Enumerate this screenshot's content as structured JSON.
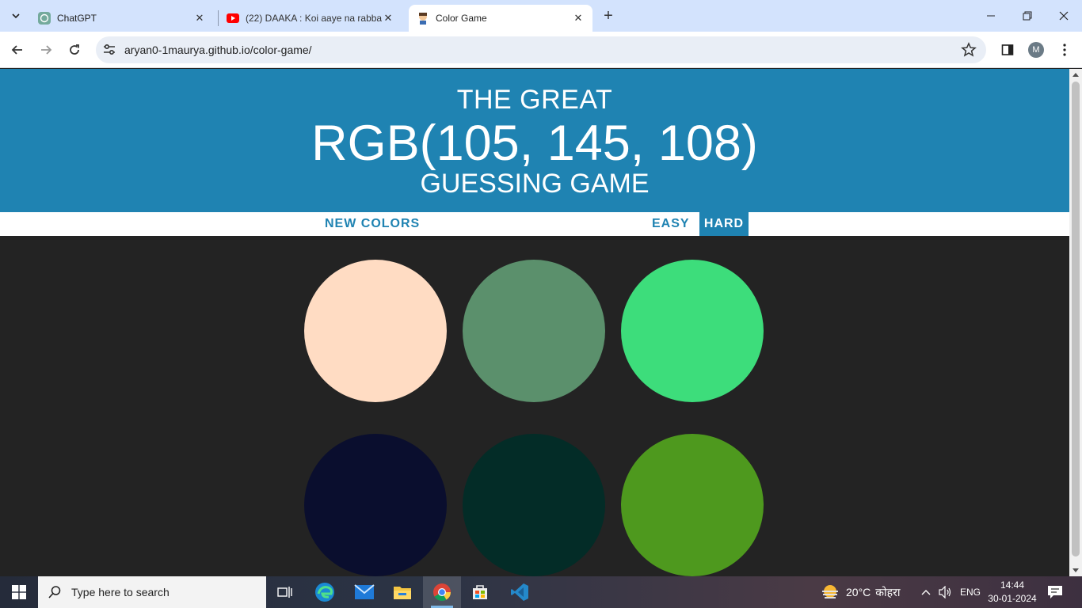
{
  "browser": {
    "tabs": [
      {
        "title": "ChatGPT",
        "icon": "chatgpt-icon",
        "active": false
      },
      {
        "title": "(22) DAAKA : Koi aaye na rabba",
        "icon": "youtube-icon",
        "active": false
      },
      {
        "title": "Color Game",
        "icon": "color-game-favicon",
        "active": true
      }
    ],
    "url": "aryan0-1maurya.github.io/color-game/",
    "profile_initial": "M"
  },
  "game": {
    "title_top": "THE GREAT",
    "rgb_display": "RGB(105, 145, 108)",
    "title_bottom": "GUESSING GAME",
    "new_colors_label": "NEW COLORS",
    "message": "",
    "easy_label": "EASY",
    "hard_label": "HARD",
    "selected_mode": "hard",
    "header_color": "#1f83b2",
    "background_color": "#232323",
    "squares": [
      {
        "color": "#ffdcc3"
      },
      {
        "color": "#5b906c"
      },
      {
        "color": "#3ddd7b"
      },
      {
        "color": "#0a0e2e"
      },
      {
        "color": "#032c27"
      },
      {
        "color": "#4e991e"
      }
    ]
  },
  "taskbar": {
    "search_placeholder": "Type here to search",
    "weather_temp": "20°C",
    "weather_text": "कोहरा",
    "language": "ENG",
    "time": "14:44",
    "date": "30-01-2024"
  }
}
